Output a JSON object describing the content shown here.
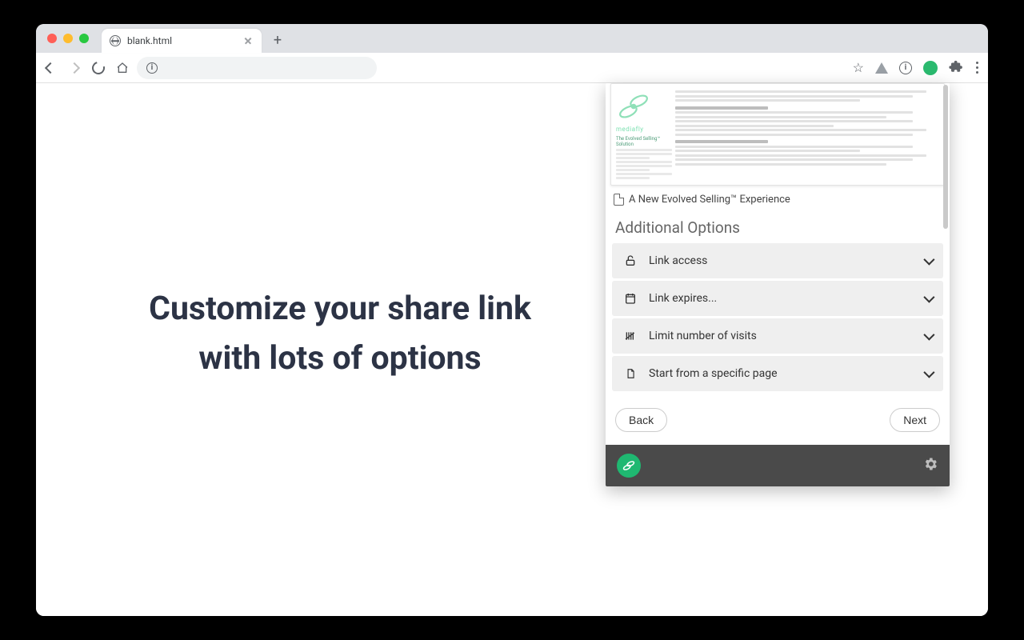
{
  "browser": {
    "tab_title": "blank.html",
    "omnibox_info_glyph": "i"
  },
  "headline": "Customize your share link with lots of options",
  "panel": {
    "doc_brand": "mediafly",
    "doc_caption": "A New Evolved Selling™ Experience",
    "section_title": "Additional Options",
    "options": [
      {
        "label": "Link access"
      },
      {
        "label": "Link expires..."
      },
      {
        "label": "Limit number of visits"
      },
      {
        "label": "Start from a specific page"
      }
    ],
    "back_label": "Back",
    "next_label": "Next"
  }
}
